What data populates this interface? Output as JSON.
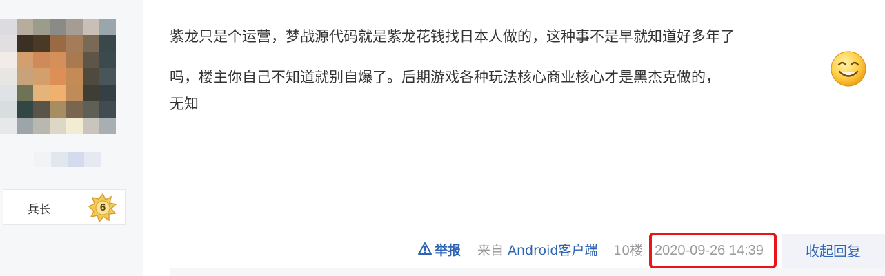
{
  "author": {
    "rank_title": "兵长",
    "rank_level": "6"
  },
  "post": {
    "lines": [
      "紫龙只是个运营，梦战源代码就是紫龙花钱找日本人做的，这种事不是早就知道好多年了",
      "吗，楼主你自己不知道就别自爆了。后期游戏各种玩法核心商业核心才是黑杰克做的，",
      "无知"
    ],
    "emoji_icon": "smiley-emoji-icon"
  },
  "post_tail": {
    "report_label": "举报",
    "source_prefix": "来自",
    "source_client": "Android客户端",
    "floor": "10楼",
    "time": "2020-09-26 14:39",
    "toggle_reply_label": "收起回复"
  },
  "colors": {
    "link_blue": "#2d64b3",
    "meta_gray": "#999999",
    "highlight_red": "#e8151b",
    "sidebar_bg": "#f6f7f9"
  }
}
